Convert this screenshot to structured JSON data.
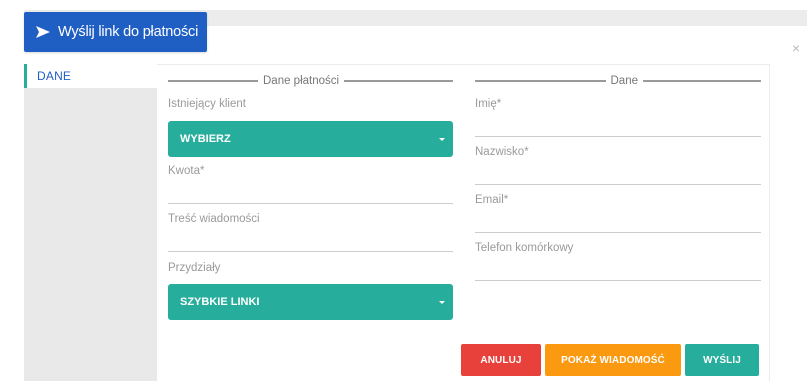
{
  "header": {
    "send_link_label": "Wyślij link do płatności",
    "send_icon": "paper-plane-icon",
    "close_symbol": "×"
  },
  "sidebar": {
    "items": [
      {
        "label": "DANE",
        "active": true
      }
    ]
  },
  "payment": {
    "legend": "Dane płatności",
    "existing_client_label": "Istniejący klient",
    "existing_client_value": "WYBIERZ",
    "amount_label": "Kwota*",
    "amount_value": "",
    "message_label": "Treść wiadomości",
    "message_value": "",
    "assignments_label": "Przydziały",
    "assignments_value": "SZYBKIE LINKI"
  },
  "client": {
    "legend": "Dane",
    "first_name_label": "Imię*",
    "last_name_label": "Nazwisko*",
    "email_label": "Email*",
    "phone_label": "Telefon komórkowy"
  },
  "actions": {
    "cancel_label": "ANULUJ",
    "show_message_label": "POKAŻ WIADOMOŚĆ",
    "send_label": "WYŚLIJ"
  },
  "colors": {
    "primary_blue": "#1f5fc4",
    "teal": "#27ad9c",
    "red": "#e8413b",
    "orange": "#fb9a11"
  }
}
